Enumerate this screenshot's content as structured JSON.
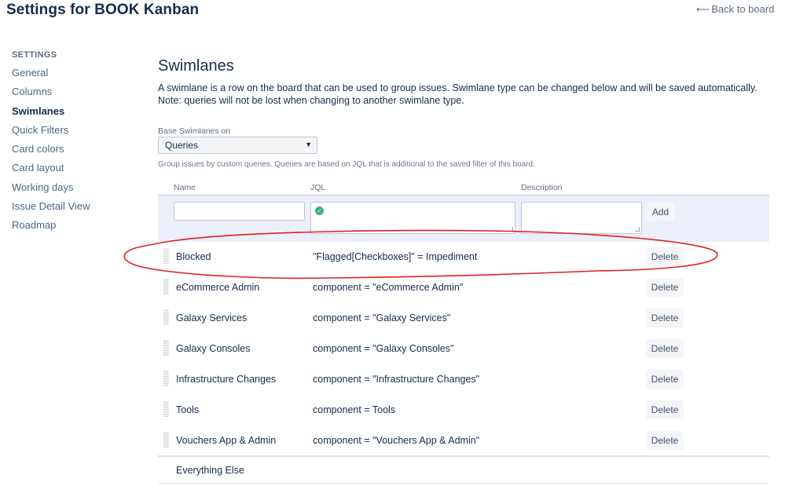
{
  "header": {
    "title": "Settings for BOOK Kanban",
    "back_arrow": "⟵",
    "back_label": "Back to board"
  },
  "sidebar": {
    "heading": "SETTINGS",
    "items": [
      {
        "label": "General"
      },
      {
        "label": "Columns"
      },
      {
        "label": "Swimlanes",
        "active": true
      },
      {
        "label": "Quick Filters"
      },
      {
        "label": "Card colors"
      },
      {
        "label": "Card layout"
      },
      {
        "label": "Working days"
      },
      {
        "label": "Issue Detail View"
      },
      {
        "label": "Roadmap"
      }
    ]
  },
  "main": {
    "title": "Swimlanes",
    "description": "A swimlane is a row on the board that can be used to group issues. Swimlane type can be changed below and will be saved automatically. Note: queries will not be lost when changing to another swimlane type.",
    "base_label": "Base Swimlanes on",
    "base_value": "Queries",
    "help_text": "Group issues by custom queries. Queries are based on JQL that is additional to the saved filter of this board.",
    "columns": {
      "name": "Name",
      "jql": "JQL",
      "description": "Description"
    },
    "add_label": "Add",
    "valid_icon": "check-circle-icon",
    "lanes": [
      {
        "name": "Blocked",
        "jql": "\"Flagged[Checkboxes]\" = Impediment",
        "delete": "Delete"
      },
      {
        "name": "eCommerce Admin",
        "jql": "component = \"eCommerce Admin\"",
        "delete": "Delete"
      },
      {
        "name": "Galaxy Services",
        "jql": "component = \"Galaxy Services\"",
        "delete": "Delete"
      },
      {
        "name": "Galaxy Consoles",
        "jql": "component = \"Galaxy Consoles\"",
        "delete": "Delete"
      },
      {
        "name": "Infrastructure Changes",
        "jql": "component = \"Infrastructure Changes\"",
        "delete": "Delete"
      },
      {
        "name": "Tools",
        "jql": "component = Tools",
        "delete": "Delete"
      },
      {
        "name": "Vouchers App & Admin",
        "jql": "component = \"Vouchers App & Admin\"",
        "delete": "Delete"
      }
    ],
    "everything_else": "Everything Else"
  },
  "colors": {
    "annotation": "#e02020",
    "add_row_bg": "#ebeffa",
    "valid": "#36b37e"
  }
}
